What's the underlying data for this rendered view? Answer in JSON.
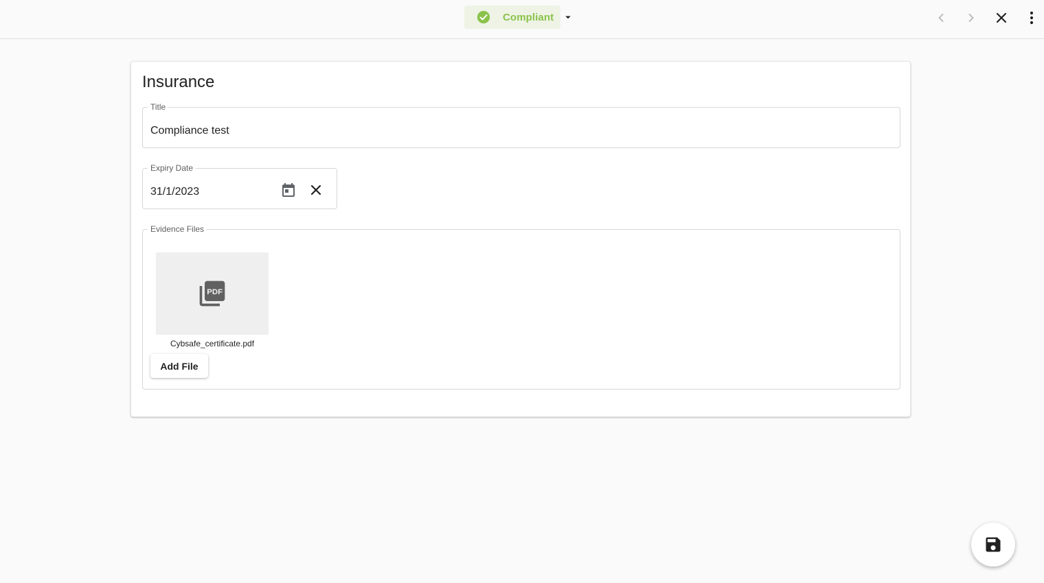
{
  "toolbar": {
    "status_label": "Compliant",
    "status_icon": "check-circle-icon",
    "status_color": "#8bc34a",
    "status_bg": "#eef3e6",
    "icons": [
      "arrow-left-icon",
      "arrow-right-icon",
      "close-icon",
      "more-vert-icon"
    ]
  },
  "form": {
    "heading": "Insurance",
    "title_field": {
      "label": "Title",
      "value": "Compliance test"
    },
    "expiry_field": {
      "label": "Expiry Date",
      "value": "31/1/2023",
      "icons": [
        "calendar-icon",
        "clear-icon"
      ]
    },
    "evidence": {
      "label": "Evidence Files",
      "files": [
        {
          "name": "Cybsafe_certificate.pdf",
          "icon": "pdf-icon"
        }
      ],
      "add_label": "Add File"
    }
  },
  "fab": {
    "icon": "save-icon"
  }
}
